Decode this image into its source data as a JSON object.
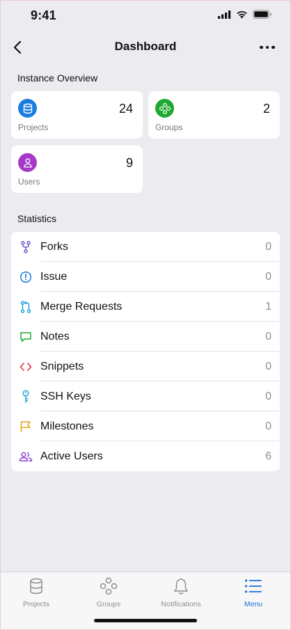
{
  "status": {
    "time": "9:41"
  },
  "nav": {
    "title": "Dashboard"
  },
  "overview": {
    "title": "Instance Overview",
    "cards": [
      {
        "name": "projects",
        "label": "Projects",
        "count": "24",
        "color": "#1a7be0",
        "icon": "database-icon"
      },
      {
        "name": "groups",
        "label": "Groups",
        "count": "2",
        "color": "#1ea830",
        "icon": "groups-icon"
      },
      {
        "name": "users",
        "label": "Users",
        "count": "9",
        "color": "#a53ac9",
        "icon": "user-icon"
      }
    ]
  },
  "statistics": {
    "title": "Statistics",
    "items": [
      {
        "label": "Forks",
        "value": "0",
        "color": "#5b4fd6",
        "icon": "fork-icon"
      },
      {
        "label": "Issue",
        "value": "0",
        "color": "#1a7be0",
        "icon": "issue-icon"
      },
      {
        "label": "Merge Requests",
        "value": "1",
        "color": "#1a9fd8",
        "icon": "merge-request-icon"
      },
      {
        "label": "Notes",
        "value": "0",
        "color": "#1ea830",
        "icon": "note-icon"
      },
      {
        "label": "Snippets",
        "value": "0",
        "color": "#e0263c",
        "icon": "code-icon"
      },
      {
        "label": "SSH Keys",
        "value": "0",
        "color": "#1aa7d8",
        "icon": "key-icon"
      },
      {
        "label": "Milestones",
        "value": "0",
        "color": "#e8a21a",
        "icon": "flag-icon"
      },
      {
        "label": "Active Users",
        "value": "6",
        "color": "#8a3ac9",
        "icon": "users-icon"
      }
    ]
  },
  "tabs": [
    {
      "label": "Projects",
      "icon": "database-icon"
    },
    {
      "label": "Groups",
      "icon": "groups-icon"
    },
    {
      "label": "Notifications",
      "icon": "bell-icon"
    },
    {
      "label": "Menu",
      "icon": "menu-icon",
      "active": true
    }
  ]
}
